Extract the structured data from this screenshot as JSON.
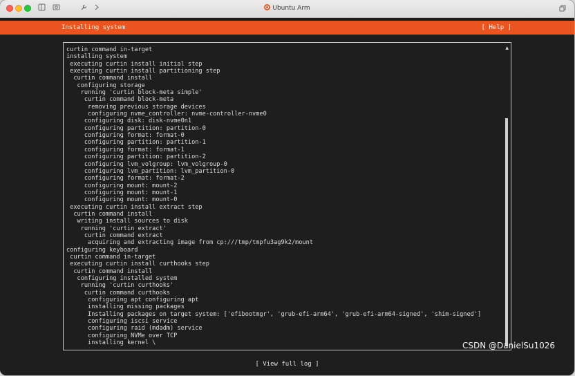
{
  "window": {
    "title": "Ubuntu Arm"
  },
  "installer": {
    "header_title": "Installing system",
    "help_label": "[ Help ]",
    "view_full_log_label": "[ View full log ]"
  },
  "log_lines": [
    "curtin command in-target",
    "installing system",
    " executing curtin install initial step",
    " executing curtin install partitioning step",
    "  curtin command install",
    "   configuring storage",
    "    running 'curtin block-meta simple'",
    "     curtin command block-meta",
    "      removing previous storage devices",
    "      configuring nvme_controller: nvme-controller-nvme0",
    "     configuring disk: disk-nvme0n1",
    "     configuring partition: partition-0",
    "     configuring format: format-0",
    "     configuring partition: partition-1",
    "     configuring format: format-1",
    "     configuring partition: partition-2",
    "     configuring lvm_volgroup: lvm_volgroup-0",
    "     configuring lvm_partition: lvm_partition-0",
    "     configuring format: format-2",
    "     configuring mount: mount-2",
    "     configuring mount: mount-1",
    "     configuring mount: mount-0",
    " executing curtin install extract step",
    "  curtin command install",
    "   writing install sources to disk",
    "    running 'curtin extract'",
    "     curtin command extract",
    "      acquiring and extracting image from cp:///tmp/tmpfu3ag9k2/mount",
    "configuring keyboard",
    " curtin command in-target",
    " executing curtin install curthooks step",
    "  curtin command install",
    "   configuring installed system",
    "    running 'curtin curthooks'",
    "     curtin command curthooks",
    "      configuring apt configuring apt",
    "      installing missing packages",
    "      Installing packages on target system: ['efibootmgr', 'grub-efi-arm64', 'grub-efi-arm64-signed', 'shim-signed']",
    "      configuring iscsi service",
    "      configuring raid (mdadm) service",
    "      configuring NVMe over TCP",
    "      installing kernel \\"
  ],
  "watermark": "CSDN @DanielSu1026",
  "colors": {
    "accent": "#e95420",
    "background": "#1e1e1e"
  },
  "icons": {
    "toolbar": [
      "sidebar-icon",
      "screenshot-icon",
      "wrench-icon",
      "chevron-right-icon"
    ],
    "title": "ubuntu-logo-icon",
    "right": "restore-window-icon"
  }
}
